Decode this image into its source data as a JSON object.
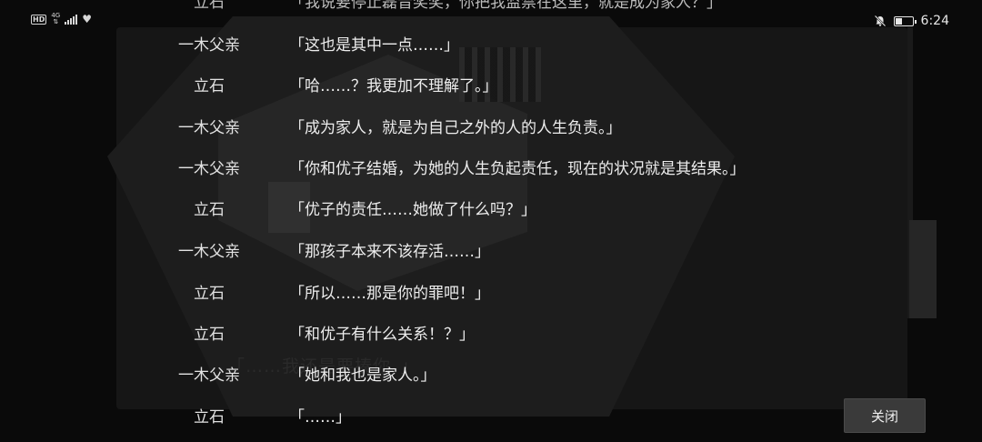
{
  "status_bar": {
    "hd": "HD",
    "network": "4G",
    "time": "6:24",
    "battery_level": 0.4,
    "icons": [
      "signal-icon",
      "heart-icon",
      "bell-off-icon",
      "battery-icon"
    ]
  },
  "dialogue_log": [
    {
      "speaker": "立石",
      "text": "「我说要停止磊音奖奖，你把我监禁在这里，就是成为家人？」"
    },
    {
      "speaker": "一木父亲",
      "text": "「这也是其中一点……」"
    },
    {
      "speaker": "立石",
      "text": "「哈……？我更加不理解了。」"
    },
    {
      "speaker": "一木父亲",
      "text": "「成为家人，就是为自己之外的人的人生负责。」"
    },
    {
      "speaker": "一木父亲",
      "text": "「你和优子结婚，为她的人生负起责任，现在的状况就是其结果。」"
    },
    {
      "speaker": "立石",
      "text": "「优子的责任……她做了什么吗？」"
    },
    {
      "speaker": "一木父亲",
      "text": "「那孩子本来不该存活……」"
    },
    {
      "speaker": "立石",
      "text": "「所以……那是你的罪吧！」"
    },
    {
      "speaker": "立石",
      "text": "「和优子有什么关系！？」"
    },
    {
      "speaker": "一木父亲",
      "text": "「她和我也是家人。」"
    },
    {
      "speaker": "立石",
      "text": "「……」"
    }
  ],
  "background_text": "「……我还是要揍你。」",
  "close_button_label": "关闭",
  "colors": {
    "background": "#0a0a0a",
    "text": "#ededed",
    "button": "#3a3a3a"
  }
}
